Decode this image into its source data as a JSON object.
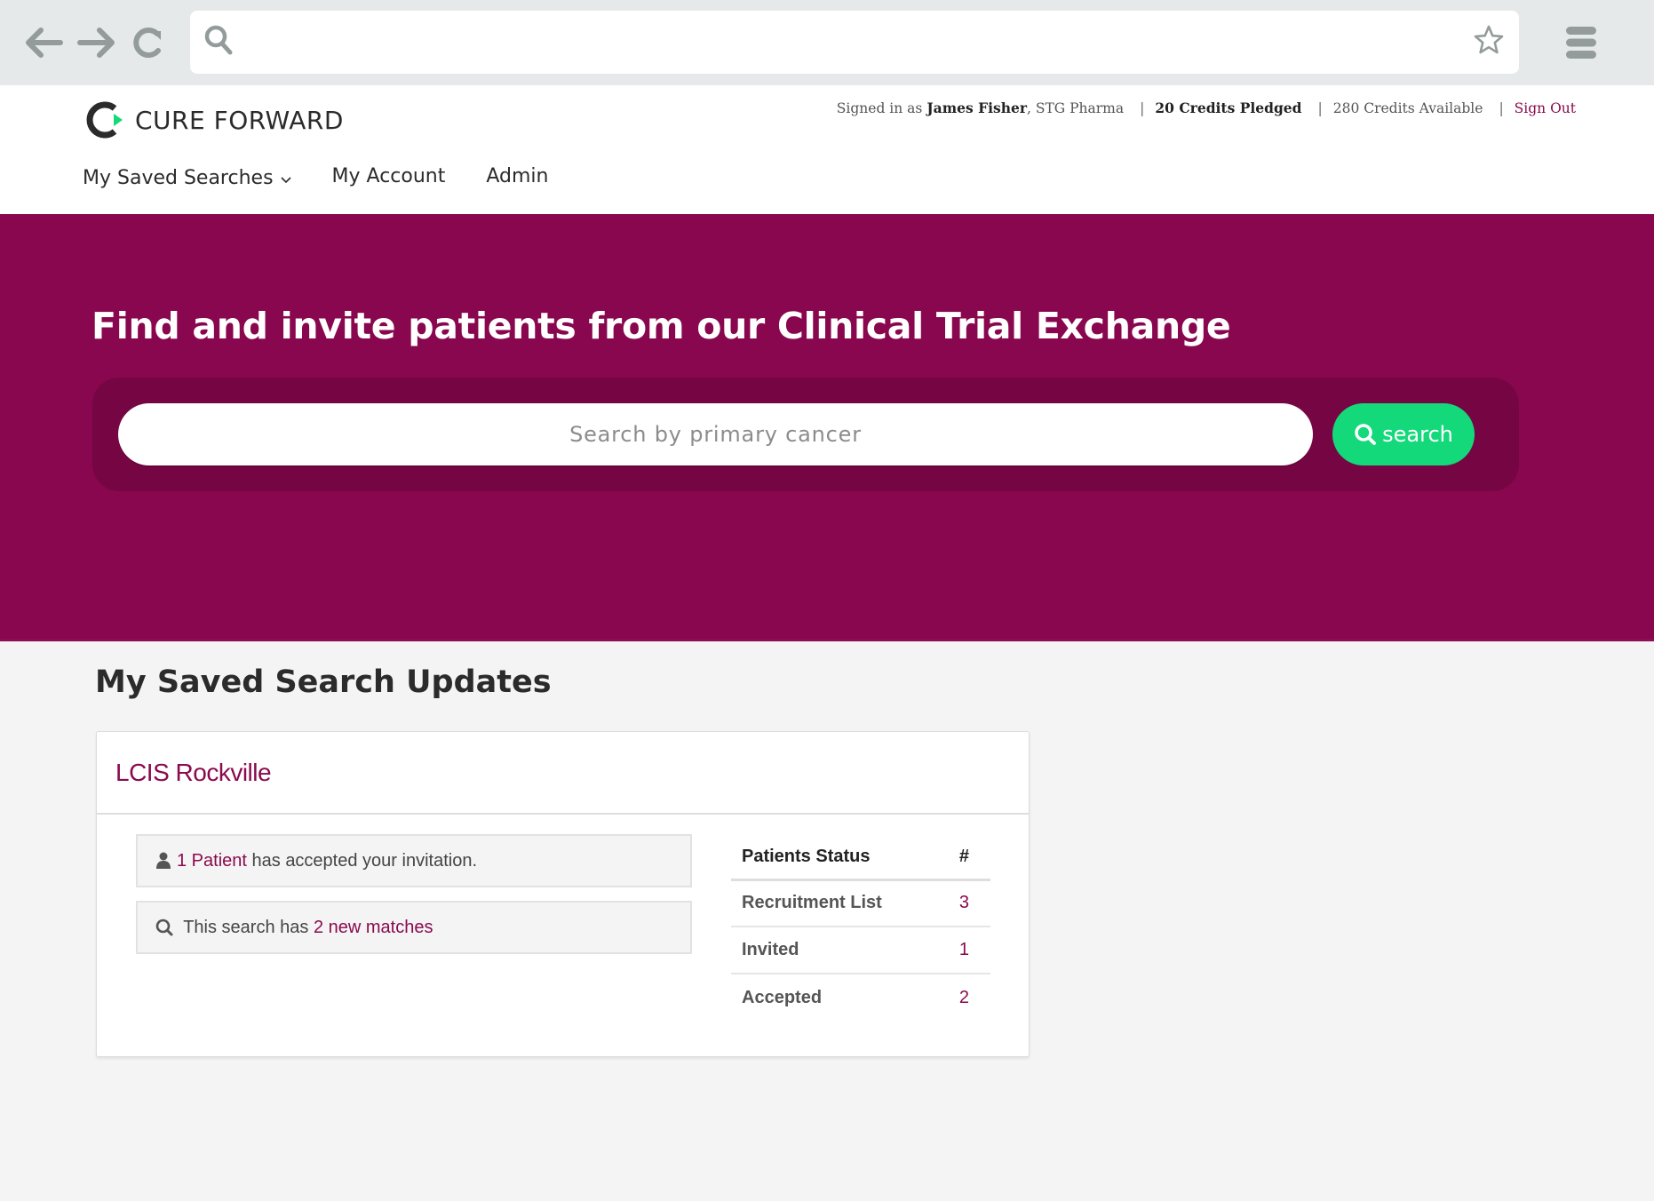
{
  "browser": {
    "back_icon": "arrow-left-icon",
    "forward_icon": "arrow-right-icon",
    "reload_icon": "reload-icon",
    "url_search_icon": "search-icon",
    "url_value": "",
    "bookmark_icon": "star-outline-icon",
    "menu_icon": "hamburger-menu-icon"
  },
  "header": {
    "logo_text": "CURE FORWARD",
    "user": {
      "signed_in_prefix": "Signed in as",
      "name": "James Fisher",
      "org": ", STG Pharma",
      "sep": "|",
      "credits_pledged": "20 Credits Pledged",
      "credits_available": "280 Credits Available",
      "sign_out": "Sign Out"
    },
    "nav": [
      {
        "label": "My Saved Searches",
        "has_dropdown": true
      },
      {
        "label": "My Account"
      },
      {
        "label": "Admin"
      }
    ]
  },
  "hero": {
    "title": "Find and invite patients from our Clinical Trial Exchange",
    "search_placeholder": "Search by primary cancer",
    "search_value": "",
    "search_button": "search"
  },
  "main": {
    "section_title": "My Saved Search Updates",
    "saved_search": {
      "title": "LCIS Rockville",
      "alerts": [
        {
          "icon": "user-icon",
          "link_text": "1 Patient",
          "text": " has accepted your invitation."
        },
        {
          "icon": "search-icon",
          "text": " This search has ",
          "link_text": "2 new matches"
        }
      ],
      "status_table": {
        "headers": [
          "Patients Status",
          "#"
        ],
        "rows": [
          {
            "label": "Recruitment List",
            "count": "3"
          },
          {
            "label": "Invited",
            "count": "1"
          },
          {
            "label": "Accepted",
            "count": "2"
          }
        ]
      }
    }
  },
  "colors": {
    "brand_magenta": "#88074e",
    "search_well": "#760643",
    "accent_green": "#13d97a",
    "link": "#8a0a4e",
    "page_bg": "#f4f4f4",
    "chrome_bg": "#e6e9ea"
  }
}
